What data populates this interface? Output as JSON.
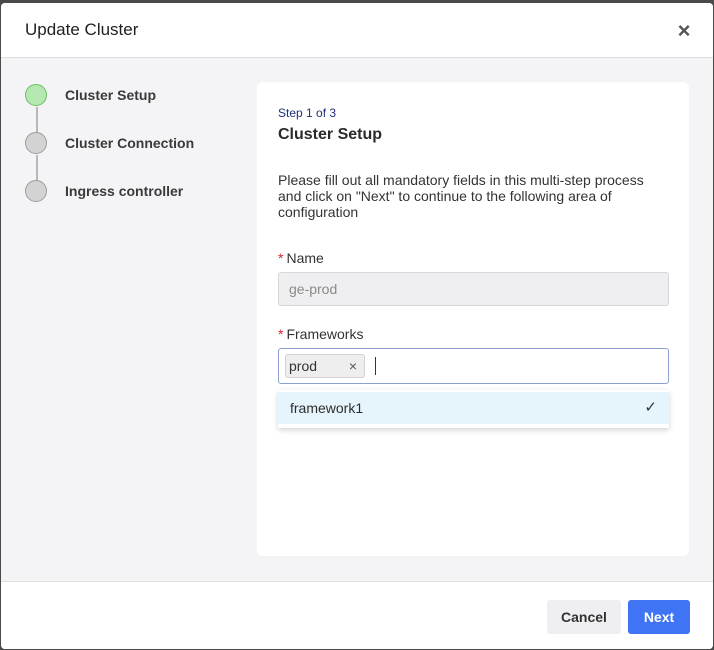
{
  "dialog": {
    "title": "Update Cluster",
    "close_icon": "close-icon"
  },
  "stepper": {
    "steps": [
      {
        "label": "Cluster Setup",
        "state": "active"
      },
      {
        "label": "Cluster Connection",
        "state": "pending"
      },
      {
        "label": "Ingress controller",
        "state": "pending"
      }
    ]
  },
  "form": {
    "step_indicator": "Step 1 of 3",
    "title": "Cluster Setup",
    "description": "Please fill out all mandatory fields in this multi-step process and click on \"Next\" to continue to the following area of configuration",
    "required_marker": "*",
    "name": {
      "label": "Name",
      "value": "ge-prod",
      "disabled": true
    },
    "frameworks": {
      "label": "Frameworks",
      "selected_tags": [
        "prod"
      ],
      "tag_remove_glyph": "×",
      "dropdown_options": [
        {
          "label": "framework1",
          "selected": true
        }
      ]
    }
  },
  "footer": {
    "cancel_label": "Cancel",
    "next_label": "Next"
  },
  "colors": {
    "accent": "#3f74f5",
    "step_active": "#b5e8b0",
    "step_pending": "#d3d3d3",
    "required": "#d8232a",
    "step_indicator": "#1f2f7a",
    "option_highlight": "#e6f4fb"
  }
}
